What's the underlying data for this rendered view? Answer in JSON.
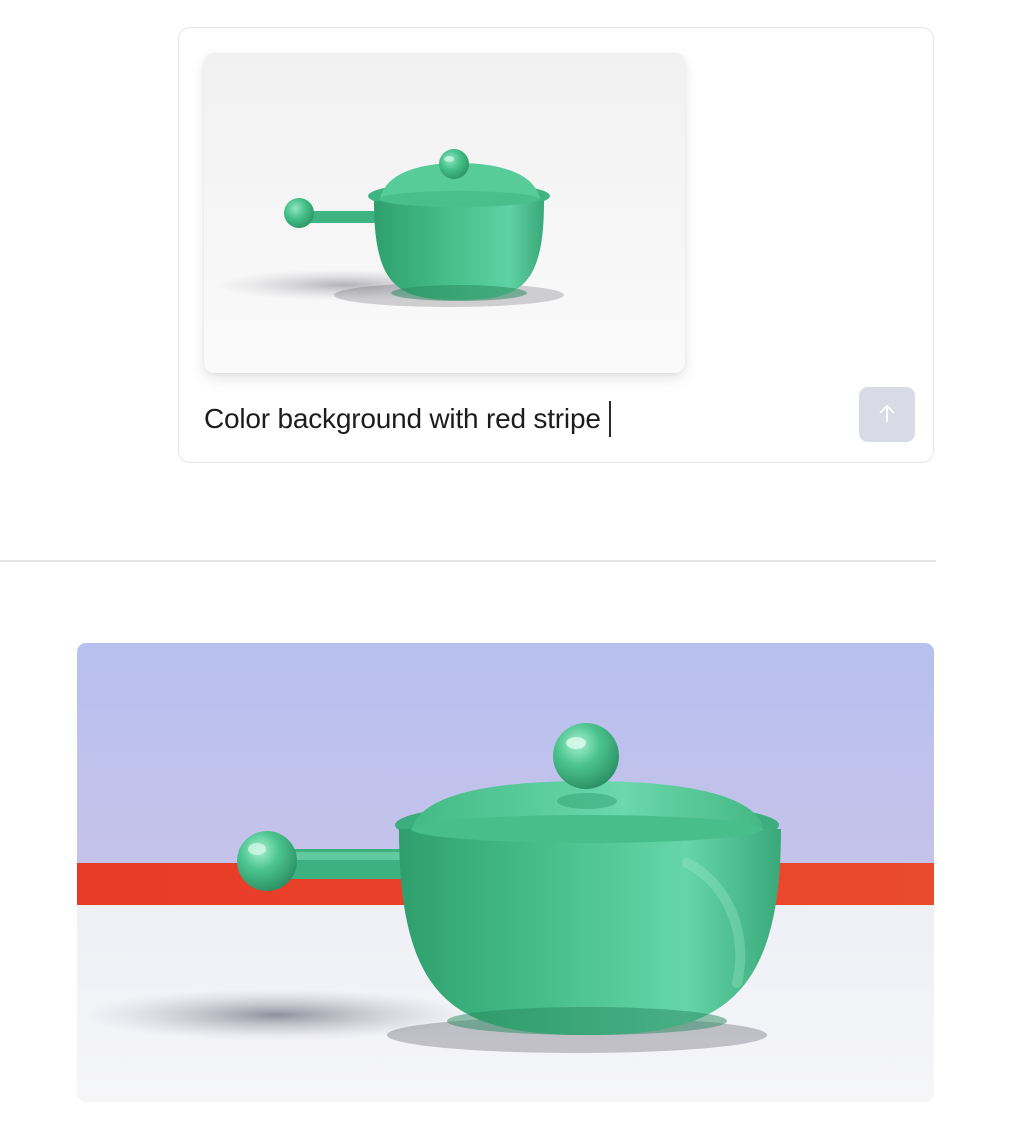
{
  "composer": {
    "attachment": {
      "name": "source-image",
      "subject": "green-pot"
    },
    "prompt_text": "Color background with red stripe",
    "send_icon": "arrow-up-icon"
  },
  "result": {
    "name": "generated-image",
    "subject": "green-pot",
    "colors": {
      "wall": "#bcc3ec",
      "stripe": "#e8412b",
      "floor": "#f3f3f5",
      "pot": "#4ec796"
    }
  }
}
